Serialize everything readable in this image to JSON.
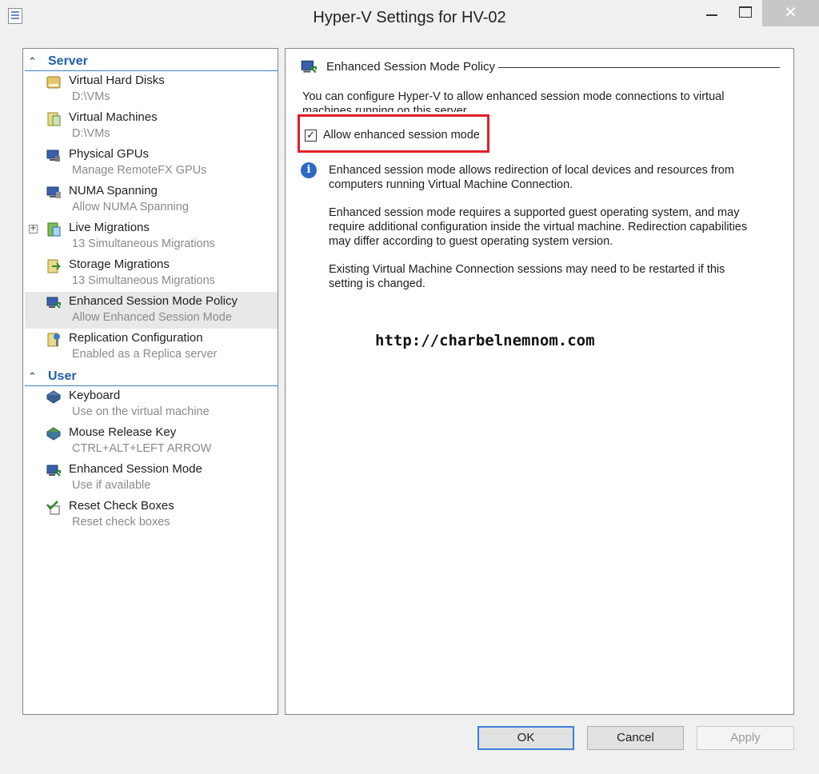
{
  "window": {
    "title": "Hyper-V Settings for HV-02",
    "minimize": "minimize",
    "maximize": "maximize",
    "close": "✕"
  },
  "sidebar": {
    "server_label": "Server",
    "user_label": "User",
    "server_items": [
      {
        "label": "Virtual Hard Disks",
        "sub": "D:\\VMs",
        "icon": "hard-disk-icon"
      },
      {
        "label": "Virtual Machines",
        "sub": "D:\\VMs",
        "icon": "virtual-machine-icon"
      },
      {
        "label": "Physical GPUs",
        "sub": "Manage RemoteFX GPUs",
        "icon": "gpu-icon"
      },
      {
        "label": "NUMA Spanning",
        "sub": "Allow NUMA Spanning",
        "icon": "numa-icon"
      },
      {
        "label": "Live Migrations",
        "sub": "13 Simultaneous Migrations",
        "icon": "live-migration-icon"
      },
      {
        "label": "Storage Migrations",
        "sub": "13 Simultaneous Migrations",
        "icon": "storage-migration-icon"
      },
      {
        "label": "Enhanced Session Mode Policy",
        "sub": "Allow Enhanced Session Mode",
        "icon": "enhanced-session-icon"
      },
      {
        "label": "Replication Configuration",
        "sub": "Enabled as a Replica server",
        "icon": "replication-icon"
      }
    ],
    "user_items": [
      {
        "label": "Keyboard",
        "sub": "Use on the virtual machine",
        "icon": "keyboard-icon"
      },
      {
        "label": "Mouse Release Key",
        "sub": "CTRL+ALT+LEFT ARROW",
        "icon": "mouse-release-icon"
      },
      {
        "label": "Enhanced Session Mode",
        "sub": "Use if available",
        "icon": "enhanced-session-icon"
      },
      {
        "label": "Reset Check Boxes",
        "sub": "Reset check boxes",
        "icon": "reset-checkbox-icon"
      }
    ]
  },
  "detail": {
    "section_title": "Enhanced Session Mode Policy",
    "intro_line1": "You can configure Hyper-V to allow enhanced session mode connections to virtual",
    "intro_line2": "machines running on this server.",
    "checkbox_label": "Allow enhanced session mode",
    "checkbox_checked": true,
    "info_p1_l1": "Enhanced session mode allows redirection of local devices and resources from",
    "info_p1_l2": "computers running Virtual Machine Connection.",
    "info_p2_l1": "Enhanced session mode requires a supported guest operating system, and may",
    "info_p2_l2": "require additional configuration inside the virtual machine. Redirection capabilities",
    "info_p2_l3": "may differ according to guest operating system version.",
    "info_p3_l1": "Existing Virtual Machine Connection sessions may need to be restarted if this",
    "info_p3_l2": "setting is changed.",
    "watermark": "http://charbelnemnom.com"
  },
  "buttons": {
    "ok": "OK",
    "cancel": "Cancel",
    "apply": "Apply"
  },
  "colors": {
    "accent": "#1f5fa8",
    "highlight_box": "#e0202a"
  }
}
